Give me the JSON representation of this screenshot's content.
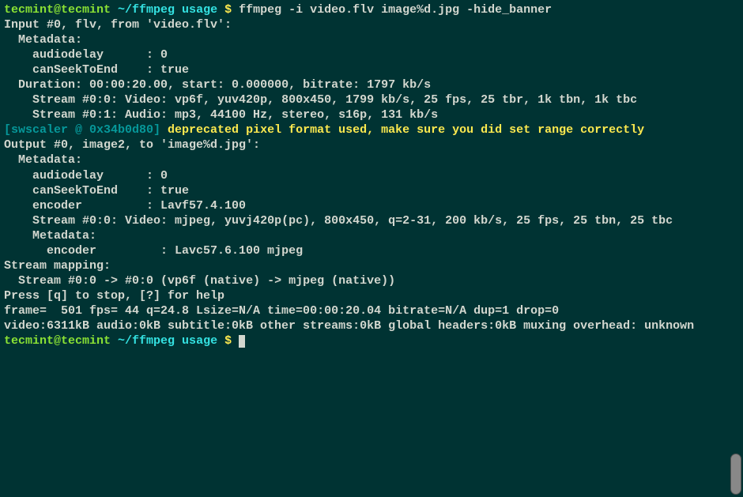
{
  "prompt1": {
    "user": "tecmint@tecmint",
    "path": "~/ffmpeg usage",
    "symbol": " $ ",
    "command": "ffmpeg -i video.flv image%d.jpg -hide_banner"
  },
  "output": {
    "l1": "Input #0, flv, from 'video.flv':",
    "l2": "  Metadata:",
    "l3": "    audiodelay      : 0",
    "l4": "    canSeekToEnd    : true",
    "l5": "  Duration: 00:00:20.00, start: 0.000000, bitrate: 1797 kb/s",
    "l6": "    Stream #0:0: Video: vp6f, yuv420p, 800x450, 1799 kb/s, 25 fps, 25 tbr, 1k tbn, 1k tbc",
    "l7": "    Stream #0:1: Audio: mp3, 44100 Hz, stereo, s16p, 131 kb/s",
    "warn_tag": "[swscaler @ 0x34b0d80] ",
    "warn_msg": "deprecated pixel format used, make sure you did set range correctly",
    "l8": "Output #0, image2, to 'image%d.jpg':",
    "l9": "  Metadata:",
    "l10": "    audiodelay      : 0",
    "l11": "    canSeekToEnd    : true",
    "l12": "    encoder         : Lavf57.4.100",
    "l13": "    Stream #0:0: Video: mjpeg, yuvj420p(pc), 800x450, q=2-31, 200 kb/s, 25 fps, 25 tbn, 25 tbc",
    "l14": "    Metadata:",
    "l15": "      encoder         : Lavc57.6.100 mjpeg",
    "l16": "Stream mapping:",
    "l17": "  Stream #0:0 -> #0:0 (vp6f (native) -> mjpeg (native))",
    "l18": "Press [q] to stop, [?] for help",
    "l19": "frame=  501 fps= 44 q=24.8 Lsize=N/A time=00:00:20.04 bitrate=N/A dup=1 drop=0",
    "l20": "video:6311kB audio:0kB subtitle:0kB other streams:0kB global headers:0kB muxing overhead: unknown"
  },
  "prompt2": {
    "user": "tecmint@tecmint",
    "path": "~/ffmpeg usage",
    "symbol": " $ "
  }
}
